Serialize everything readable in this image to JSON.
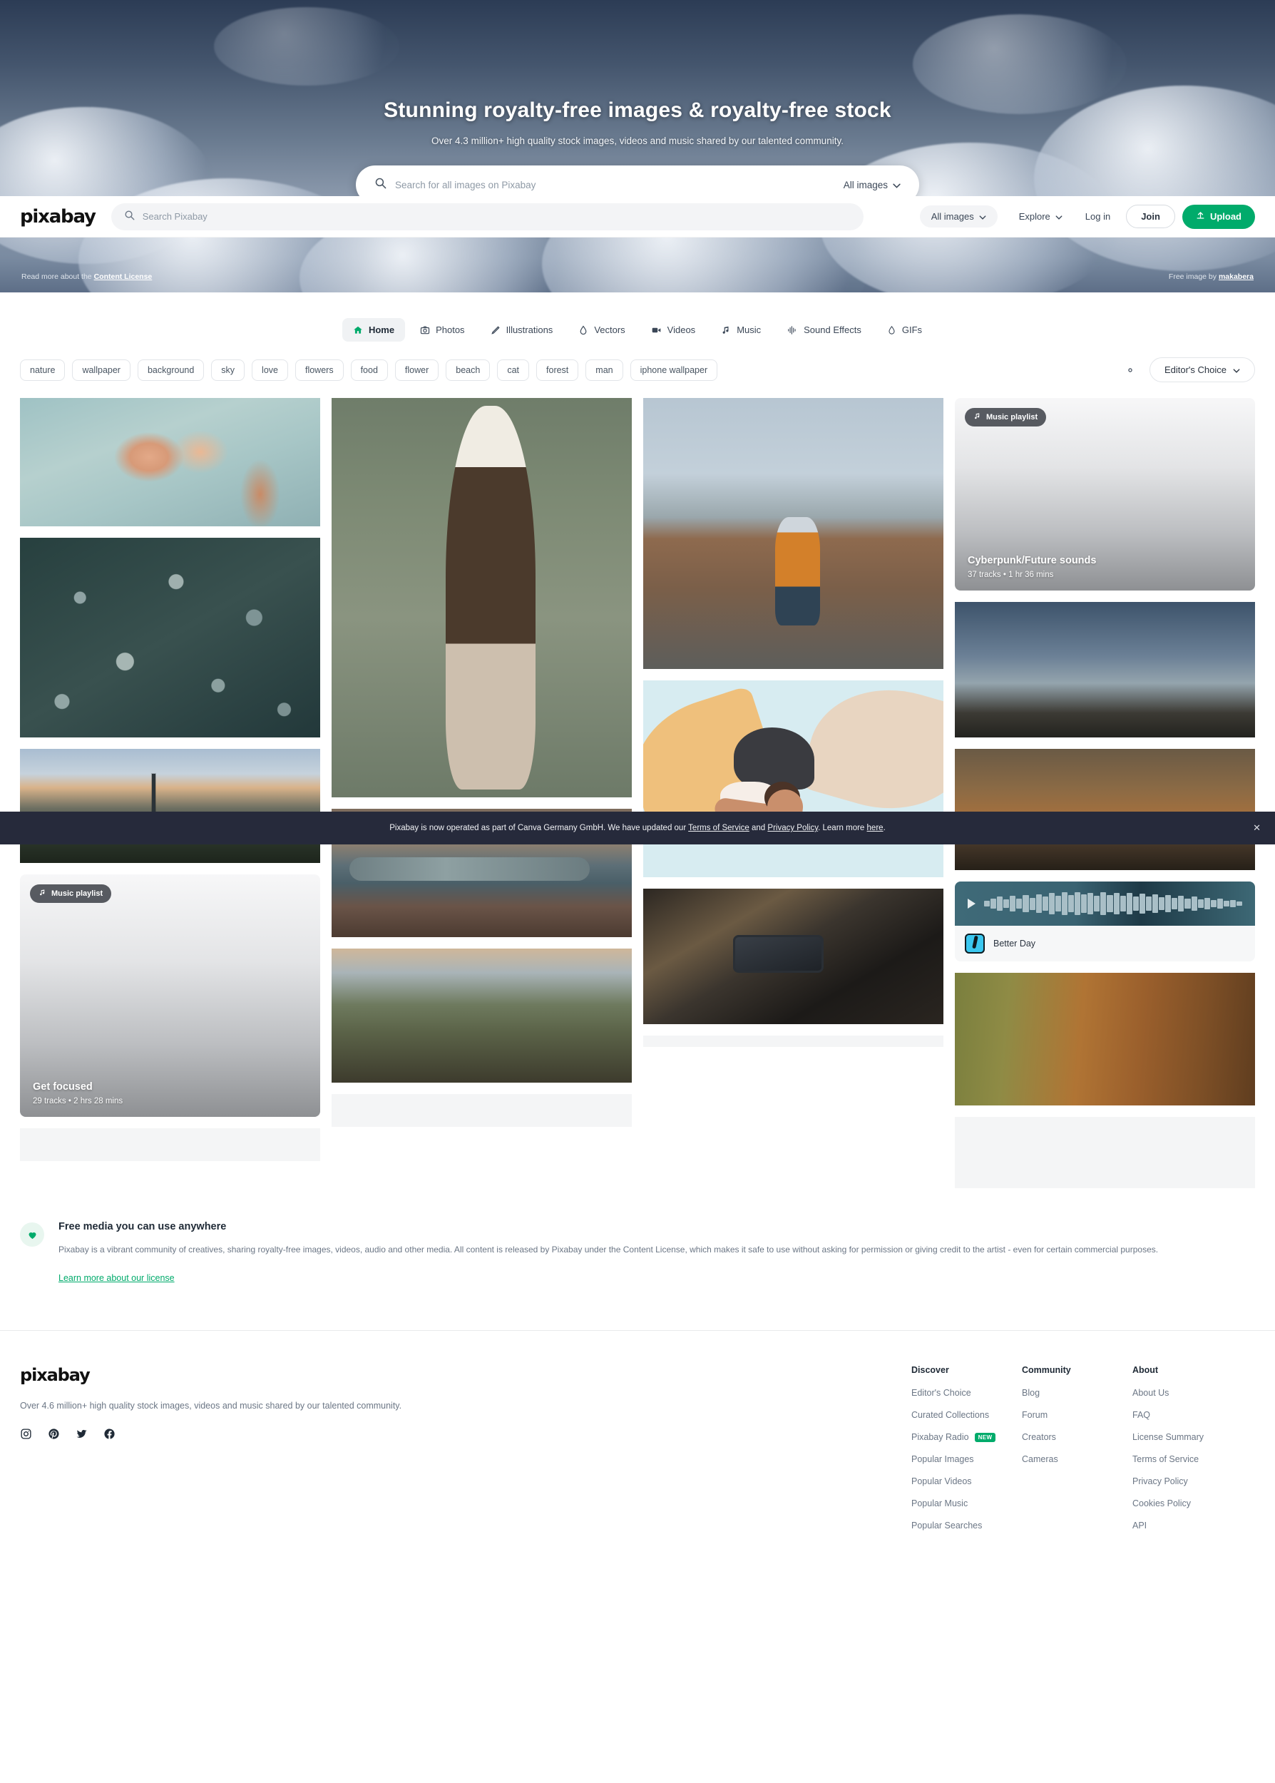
{
  "hero": {
    "title": "Stunning royalty-free images & royalty-free stock",
    "subtitle": "Over 4.3 million+ high quality stock images, videos and music shared by our talented community.",
    "search_placeholder": "Search for all images on Pixabay",
    "search_value": "",
    "media_filter": "All images",
    "license_prefix": "Read more about the",
    "license_link": "Content License",
    "credit_prefix": "Free image by",
    "credit_author": "makabera"
  },
  "topnav": {
    "logo": "pixabay",
    "search_placeholder": "Search Pixabay",
    "search_value": "",
    "media_filter": "All images",
    "explore": "Explore",
    "login": "Log in",
    "join": "Join",
    "upload": "Upload"
  },
  "tabs": [
    {
      "label": "Home",
      "icon": "home-icon",
      "active": true
    },
    {
      "label": "Photos",
      "icon": "camera-icon",
      "active": false
    },
    {
      "label": "Illustrations",
      "icon": "pencil-icon",
      "active": false
    },
    {
      "label": "Vectors",
      "icon": "pen-nib-icon",
      "active": false
    },
    {
      "label": "Videos",
      "icon": "video-camera-icon",
      "active": false
    },
    {
      "label": "Music",
      "icon": "music-note-icon",
      "active": false
    },
    {
      "label": "Sound Effects",
      "icon": "waveform-icon",
      "active": false
    },
    {
      "label": "GIFs",
      "icon": "gif-icon",
      "active": false
    }
  ],
  "chips": [
    "nature",
    "wallpaper",
    "background",
    "sky",
    "love",
    "flowers",
    "food",
    "flower",
    "beach",
    "cat",
    "forest",
    "man",
    "iphone wallpaper"
  ],
  "toolbar": {
    "settings_icon": "gear-icon",
    "sort_label": "Editor's Choice"
  },
  "cards": {
    "playlist_badge": "Music playlist",
    "playlist_cyberpunk": {
      "title": "Cyberpunk/Future sounds",
      "tracks": "37 tracks",
      "separator": "•",
      "duration": "1 hr 36 mins"
    },
    "playlist_focus": {
      "title": "Get focused",
      "tracks": "29 tracks",
      "separator": "•",
      "duration": "2 hrs 28 mins"
    },
    "audio_track": {
      "title": "Better Day"
    }
  },
  "banner": {
    "text_1": "Pixabay is now operated as part of Canva Germany GmbH. We have updated our",
    "link_1": "Terms of Service",
    "text_2": "and",
    "link_2": "Privacy Policy",
    "text_3": ". Learn more",
    "link_3": "here",
    "text_4": ".",
    "close_icon": "close-icon"
  },
  "info": {
    "icon": "heart-icon",
    "heading": "Free media you can use anywhere",
    "body": "Pixabay is a vibrant community of creatives, sharing royalty-free images, videos, audio and other media. All content is released by Pixabay under the Content License, which makes it safe to use without asking for permission or giving credit to the artist - even for certain commercial purposes.",
    "link": "Learn more about our license"
  },
  "footer": {
    "logo": "pixabay",
    "tagline": "Over 4.6 million+ high quality stock images, videos and music shared by our talented community.",
    "social": [
      "instagram-icon",
      "pinterest-icon",
      "twitter-icon",
      "facebook-icon"
    ],
    "columns": [
      {
        "heading": "Discover",
        "items": [
          {
            "label": "Editor's Choice"
          },
          {
            "label": "Curated Collections"
          },
          {
            "label": "Pixabay Radio",
            "badge": "NEW"
          },
          {
            "label": "Popular Images"
          },
          {
            "label": "Popular Videos"
          },
          {
            "label": "Popular Music"
          },
          {
            "label": "Popular Searches"
          }
        ]
      },
      {
        "heading": "Community",
        "items": [
          {
            "label": "Blog"
          },
          {
            "label": "Forum"
          },
          {
            "label": "Creators"
          },
          {
            "label": "Cameras"
          }
        ]
      },
      {
        "heading": "About",
        "items": [
          {
            "label": "About Us"
          },
          {
            "label": "FAQ"
          },
          {
            "label": "License Summary"
          },
          {
            "label": "Terms of Service"
          },
          {
            "label": "Privacy Policy"
          },
          {
            "label": "Cookies Policy"
          },
          {
            "label": "API"
          }
        ]
      }
    ]
  },
  "colors": {
    "brand_green": "#00ab6b",
    "banner_bg": "#262a3b",
    "text_dark": "#1f2a36",
    "text_muted": "#6b7685"
  }
}
